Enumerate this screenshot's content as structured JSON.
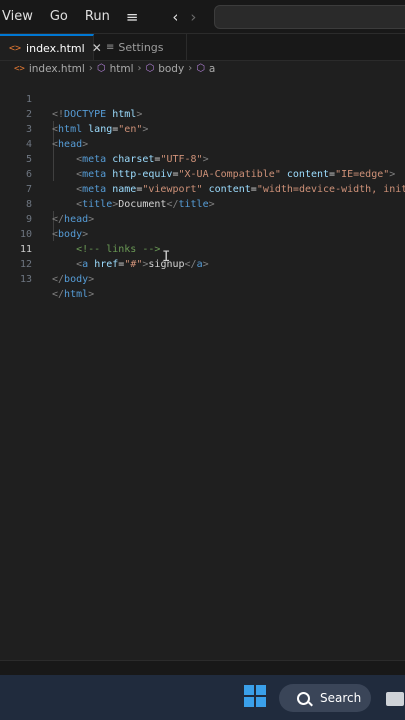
{
  "menu": {
    "items": [
      "View",
      "Go",
      "Run"
    ],
    "hamburger_icon": "hamburger-menu-icon",
    "back_icon": "chevron-left-icon",
    "forward_icon": "chevron-right-icon"
  },
  "tabs": [
    {
      "label": "index.html",
      "icon": "html-file-icon",
      "active": true
    },
    {
      "label": "Settings",
      "icon": "settings-icon",
      "active": false
    }
  ],
  "breadcrumb": [
    "index.html",
    "html",
    "body",
    "a"
  ],
  "editor": {
    "current_line": 11,
    "line_numbers": [
      "1",
      "2",
      "3",
      "4",
      "5",
      "6",
      "7",
      "8",
      "9",
      "10",
      "11",
      "12",
      "13"
    ]
  },
  "code_strings": {
    "doctype": "DOCTYPE",
    "html": "html",
    "lang": "lang",
    "lang_val": "\"en\"",
    "head": "head",
    "meta": "meta",
    "charset": "charset",
    "charset_val": "\"UTF-8\"",
    "http_equiv": "http-equiv",
    "http_equiv_val": "\"X-UA-Compatible\"",
    "content": "content",
    "content_val1": "\"IE=edge\"",
    "name": "name",
    "name_val": "\"viewport\"",
    "content_val2": "\"width=device-width, init",
    "title": "title",
    "title_text": "Document",
    "body": "body",
    "comment": "<!-- links -->",
    "a": "a",
    "href": "href",
    "href_val": "\"#\"",
    "link_text": "signup"
  },
  "taskbar": {
    "search_label": "Search",
    "accent": "#3aa0ea"
  },
  "colors": {
    "tag": "#569cd6",
    "attribute": "#9cdcfe",
    "string": "#ce9178",
    "comment": "#6a9955",
    "active_tab_border": "#0078d4"
  }
}
